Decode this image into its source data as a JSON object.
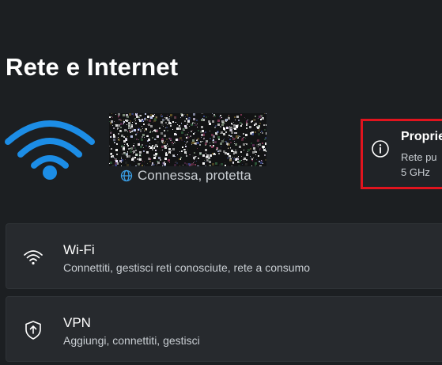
{
  "header": {
    "title": "Rete e Internet"
  },
  "network": {
    "status": "Connessa, protetta",
    "status_icon": "globe-icon",
    "name_icon": "wifi-signal-icon"
  },
  "properties_card": {
    "title": "Proprie",
    "line1": "Rete pu",
    "line2": "5 GHz",
    "icon": "info-icon",
    "highlight_color": "#e1141e"
  },
  "settings": [
    {
      "title": "Wi-Fi",
      "subtitle": "Connettiti, gestisci reti conosciute, rete a consumo",
      "icon": "wifi-icon"
    },
    {
      "title": "VPN",
      "subtitle": "Aggiungi, connettiti, gestisci",
      "icon": "shield-icon"
    }
  ],
  "colors": {
    "background": "#1c1f22",
    "card": "#272a2e",
    "accent_wifi": "#1c8de6"
  }
}
